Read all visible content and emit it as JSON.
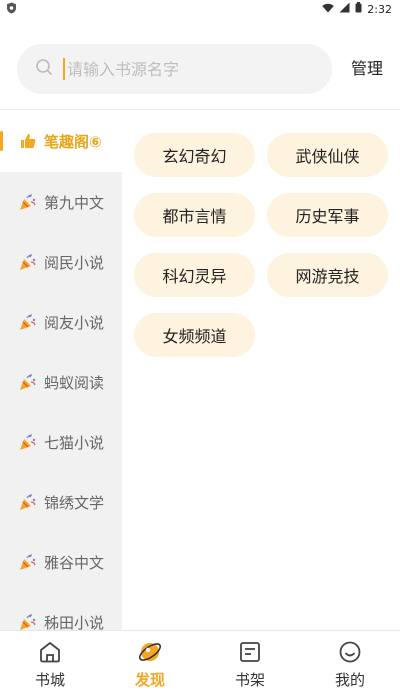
{
  "status_bar": {
    "time": "2:32",
    "icons": [
      "shield-icon",
      "wifi-icon",
      "signal-icon",
      "battery-icon"
    ]
  },
  "search": {
    "placeholder": "请输入书源名字",
    "manage_label": "管理"
  },
  "sidebar": {
    "items": [
      {
        "label": "笔趣阁⑥",
        "icon": "thumbs-up-icon",
        "active": true
      },
      {
        "label": "第九中文",
        "icon": "party-popper-icon"
      },
      {
        "label": "阅民小说",
        "icon": "party-popper-icon"
      },
      {
        "label": "阅友小说",
        "icon": "party-popper-icon"
      },
      {
        "label": "蚂蚁阅读",
        "icon": "party-popper-icon"
      },
      {
        "label": "七猫小说",
        "icon": "party-popper-icon"
      },
      {
        "label": "锦绣文学",
        "icon": "party-popper-icon"
      },
      {
        "label": "雅谷中文",
        "icon": "party-popper-icon"
      },
      {
        "label": "秭田小说",
        "icon": "party-popper-icon"
      }
    ]
  },
  "tags": [
    {
      "label": "玄幻奇幻"
    },
    {
      "label": "武侠仙侠"
    },
    {
      "label": "都市言情"
    },
    {
      "label": "历史军事"
    },
    {
      "label": "科幻灵异"
    },
    {
      "label": "网游竞技"
    },
    {
      "label": "女频频道"
    }
  ],
  "bottom_nav": {
    "items": [
      {
        "label": "书城",
        "icon": "home-icon"
      },
      {
        "label": "发现",
        "icon": "discover-icon",
        "active": true
      },
      {
        "label": "书架",
        "icon": "bookshelf-icon"
      },
      {
        "label": "我的",
        "icon": "profile-icon"
      }
    ]
  },
  "colors": {
    "accent": "#f5a623",
    "tag_bg": "#fdf3de",
    "sidebar_bg": "#f1f1f1"
  }
}
